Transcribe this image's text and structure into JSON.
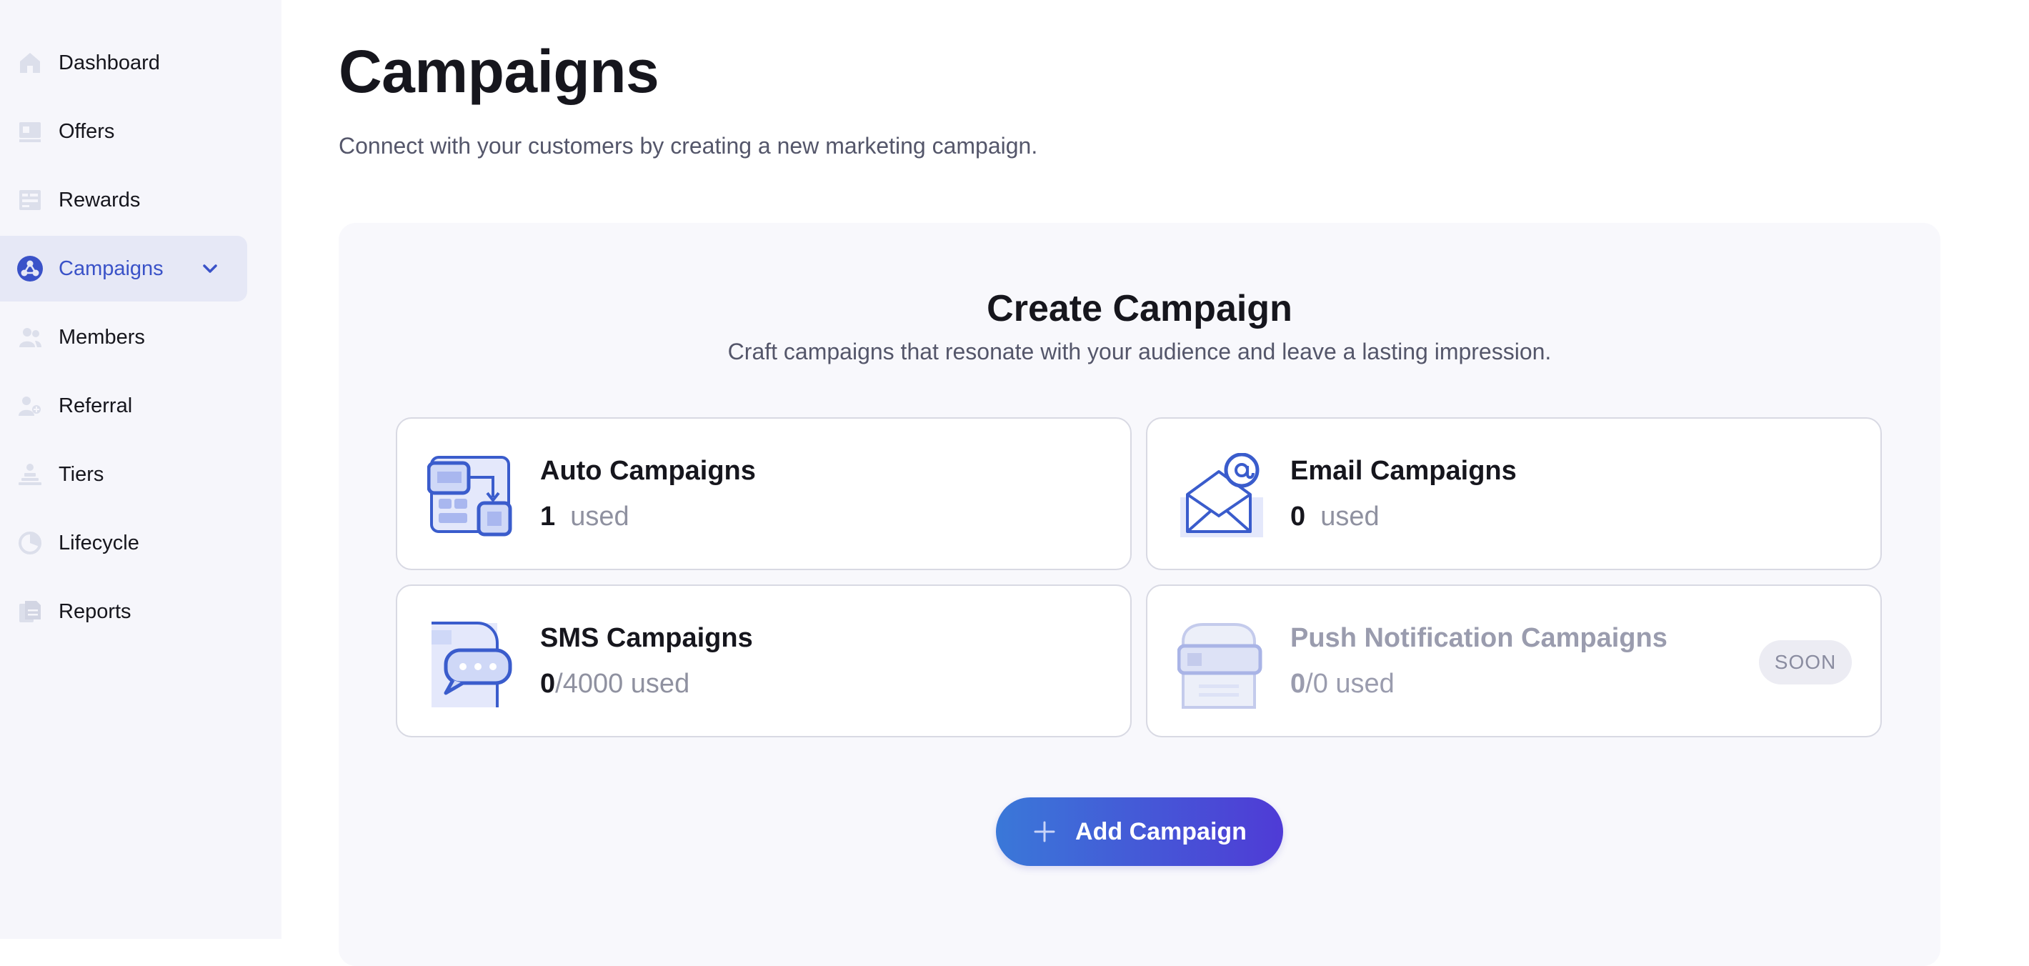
{
  "sidebar": {
    "items": [
      {
        "label": "Dashboard",
        "icon": "home-icon"
      },
      {
        "label": "Offers",
        "icon": "offers-icon"
      },
      {
        "label": "Rewards",
        "icon": "rewards-icon"
      },
      {
        "label": "Campaigns",
        "icon": "campaigns-icon",
        "active": true
      },
      {
        "label": "Members",
        "icon": "members-icon"
      },
      {
        "label": "Referral",
        "icon": "referral-icon"
      },
      {
        "label": "Tiers",
        "icon": "tiers-icon"
      },
      {
        "label": "Lifecycle",
        "icon": "lifecycle-icon"
      },
      {
        "label": "Reports",
        "icon": "reports-icon"
      }
    ]
  },
  "header": {
    "title": "Campaigns",
    "subtitle": "Connect with your customers by creating a new marketing campaign."
  },
  "create": {
    "title": "Create Campaign",
    "subtitle": "Craft campaigns that resonate with your audience and leave a lasting impression.",
    "cards": [
      {
        "title": "Auto Campaigns",
        "used": "1",
        "limit": "",
        "suffix": "used",
        "icon": "auto-campaign-icon"
      },
      {
        "title": "Email Campaigns",
        "used": "0",
        "limit": "",
        "suffix": "used",
        "icon": "email-campaign-icon"
      },
      {
        "title": "SMS Campaigns",
        "used": "0",
        "limit": "/4000",
        "suffix": "used",
        "icon": "sms-campaign-icon"
      },
      {
        "title": "Push Notification Campaigns",
        "used": "0",
        "limit": "/0",
        "suffix": "used",
        "icon": "push-notification-icon",
        "badge": "SOON"
      }
    ],
    "add_button_label": "Add Campaign"
  },
  "colors": {
    "accent": "#3a52c8",
    "icon_blue": "#3a5ccc",
    "sidebar_bg": "#f6f6fb",
    "active_bg": "#e6e8f6",
    "button_gradient_start": "#3a78d8",
    "button_gradient_end": "#4f3bd6"
  }
}
